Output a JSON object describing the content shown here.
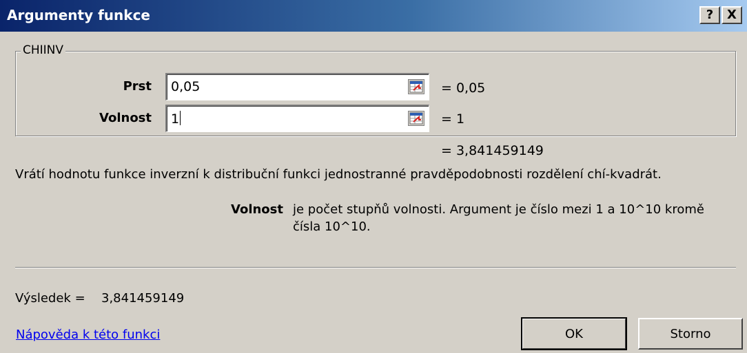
{
  "window": {
    "title": "Argumenty funkce",
    "help_glyph": "?",
    "close_glyph": "X"
  },
  "function_group": {
    "name": "CHIINV",
    "arguments": [
      {
        "label": "Prst",
        "value": "0,05",
        "result": "=  0,05"
      },
      {
        "label": "Volnost",
        "value": "1",
        "result": "=  1"
      }
    ]
  },
  "formula_result": "=  3,841459149",
  "function_description": "Vrátí hodnotu funkce inverzní k distribuční funkci jednostranné pravděpodobnosti rozdělení chí-kvadrát.",
  "argument_help": {
    "name": "Volnost",
    "line1": "je počet stupňů volnosti. Argument je číslo mezi 1 a 10^10 kromě",
    "line2": "čísla 10^10."
  },
  "result": {
    "label": "Výsledek =",
    "value": "3,841459149"
  },
  "help_link": "Nápověda k této funkci",
  "buttons": {
    "ok": "OK",
    "cancel": "Storno"
  },
  "icons": {
    "ref_button": "collapse-dialog-icon"
  }
}
